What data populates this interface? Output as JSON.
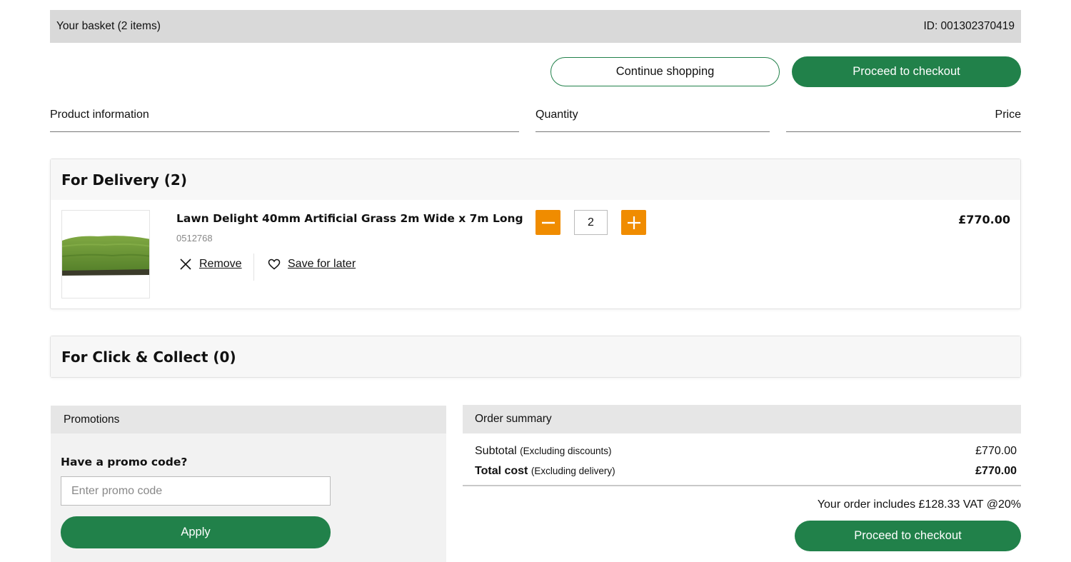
{
  "basket": {
    "title": "Your basket (2 items)",
    "id_label": "ID: 001302370419"
  },
  "actions": {
    "continue_label": "Continue shopping",
    "checkout_label": "Proceed to checkout"
  },
  "columns": {
    "product": "Product information",
    "quantity": "Quantity",
    "price": "Price"
  },
  "delivery": {
    "heading": "For Delivery (2)",
    "item": {
      "name": "Lawn Delight 40mm Artificial Grass 2m Wide x 7m Long",
      "code": "0512768",
      "quantity": "2",
      "price": "£770.00",
      "remove_label": "Remove",
      "save_label": "Save for later",
      "image_icon": "artificial-grass-image"
    }
  },
  "collect": {
    "heading": "For Click & Collect (0)"
  },
  "promotions": {
    "heading": "Promotions",
    "question": "Have a promo code?",
    "placeholder": "Enter promo code",
    "apply_label": "Apply"
  },
  "summary": {
    "heading": "Order summary",
    "subtotal_label": "Subtotal",
    "subtotal_note": "(Excluding discounts)",
    "subtotal_value": "£770.00",
    "total_label": "Total cost",
    "total_note": "(Excluding delivery)",
    "total_value": "£770.00",
    "vat_text": "Your order includes £128.33 VAT @20%",
    "checkout_label": "Proceed to checkout"
  },
  "colors": {
    "brand_green": "#21814a",
    "qty_orange": "#f08c00",
    "header_grey": "#d9d9d9"
  }
}
